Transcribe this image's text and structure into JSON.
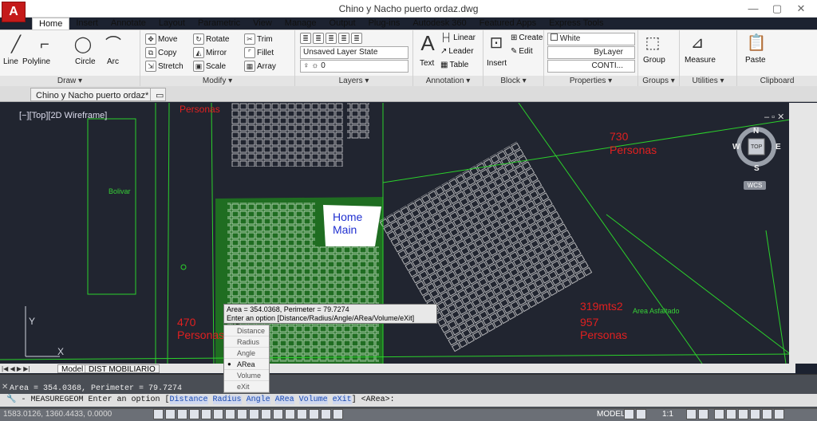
{
  "title": "Chino y Nacho puerto ordaz.dwg",
  "app_logo": "A",
  "window_controls": {
    "minimize": "—",
    "maximize": "▢",
    "close": "✕"
  },
  "tabs": [
    "Home",
    "Insert",
    "Annotate",
    "Layout",
    "Parametric",
    "View",
    "Manage",
    "Output",
    "Plug-ins",
    "Autodesk 360",
    "Featured Apps",
    "Express Tools"
  ],
  "ribbon": {
    "draw": {
      "title": "Draw ▾",
      "items": [
        "Line",
        "Polyline",
        "Circle",
        "Arc"
      ]
    },
    "modify": {
      "title": "Modify ▾",
      "items": [
        "Move",
        "Rotate",
        "Trim",
        "Copy",
        "Mirror",
        "Fillet",
        "Stretch",
        "Scale",
        "Array"
      ]
    },
    "layers": {
      "title": "Layers ▾",
      "layer_state": "Unsaved Layer State",
      "current_layer": "0"
    },
    "annotation": {
      "title": "Annotation ▾",
      "text": "Text",
      "linear": "Linear",
      "leader": "Leader",
      "table": "Table"
    },
    "block": {
      "title": "Block ▾",
      "insert": "Insert",
      "create": "Create",
      "edit": "Edit"
    },
    "properties": {
      "title": "Properties ▾",
      "color": "White",
      "linetype": "ByLayer",
      "lineweight": "CONTI..."
    },
    "groups": {
      "title": "Groups ▾",
      "group": "Group"
    },
    "utilities": {
      "title": "Utilities ▾",
      "measure": "Measure"
    },
    "clipboard": {
      "title": "Clipboard",
      "paste": "Paste"
    }
  },
  "file_tab": "Chino y Nacho puerto ordaz*",
  "viewport_label": "[−][Top][2D Wireframe]",
  "viewcube": {
    "n": "N",
    "s": "S",
    "e": "E",
    "w": "W",
    "top": "TOP",
    "wcs": "WCS"
  },
  "drawing_labels": {
    "personas_top": "Personas",
    "top_right_count": "730",
    "top_right_personas": "Personas",
    "home_main_1": "Home",
    "home_main_2": "Main",
    "left_count": "470",
    "left_personas": "Personas",
    "area_m2": "319mts2",
    "right_count": "957",
    "right_personas": "Personas",
    "green_1": "Bolivar",
    "green_2": "Area Asfaltado"
  },
  "measure_tooltip": {
    "line1": "Area = 354.0368, Perimeter = 79.7274",
    "line2": "Enter an option [Distance/Radius/Angle/ARea/Volume/eXit] <ARea>:"
  },
  "measure_menu": [
    "Distance",
    "Radius",
    "Angle",
    "ARea",
    "Volume",
    "eXit"
  ],
  "measure_selected": "ARea",
  "sheet_tabs": [
    "Model",
    "DIST MOBILIARIO"
  ],
  "command_history": "Area = 354.0368, Perimeter = 79.7274",
  "command_prompt": {
    "cmd": "- MEASUREGEOM Enter an option [",
    "opts": [
      "Distance",
      "Radius",
      "Angle",
      "ARea",
      "Volume",
      "eXit"
    ],
    "tail": "] <ARea>:"
  },
  "coordinates": "1583.0126, 1360.4433, 0.0000",
  "status_model": "MODEL",
  "status_scale": "1:1"
}
